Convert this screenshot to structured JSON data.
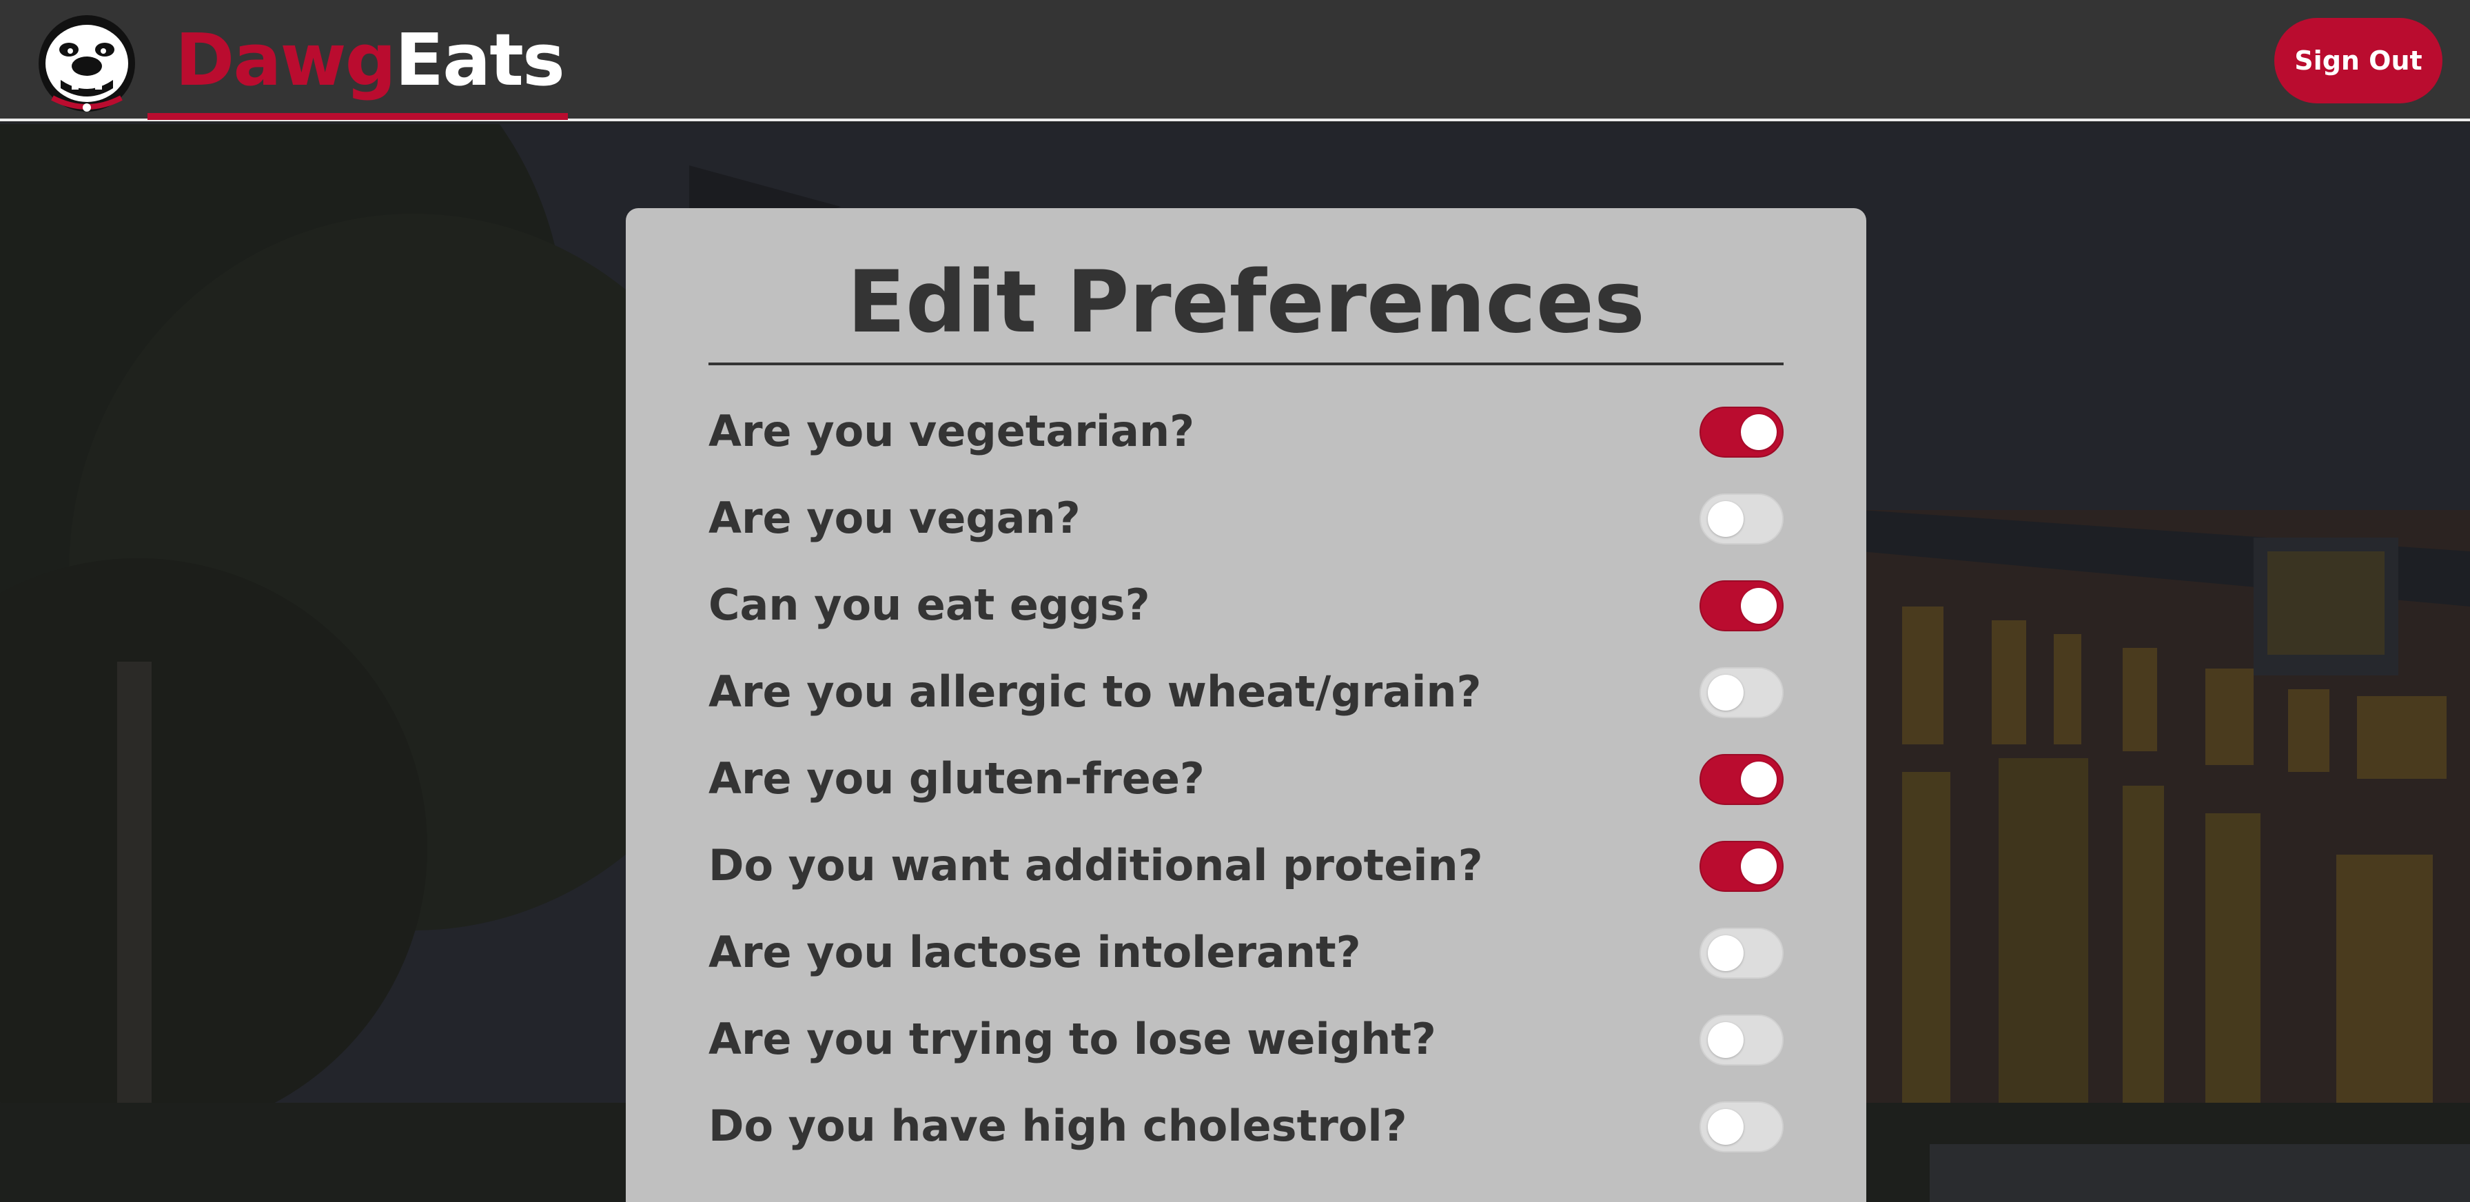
{
  "header": {
    "brand_part1": "Dawg",
    "brand_part2": "Eats",
    "signout_label": "Sign Out",
    "logo_alt": "Bulldog mascot logo"
  },
  "colors": {
    "accent": "#ba0c2f",
    "header_bg": "#343434",
    "card_bg": "#c0c0c0",
    "text_dark": "#343434"
  },
  "card": {
    "title": "Edit Preferences",
    "preferences": [
      {
        "label": "Are you vegetarian?",
        "enabled": true
      },
      {
        "label": "Are you vegan?",
        "enabled": false
      },
      {
        "label": "Can you eat eggs?",
        "enabled": true
      },
      {
        "label": "Are you allergic to wheat/grain?",
        "enabled": false
      },
      {
        "label": "Are you gluten-free?",
        "enabled": true
      },
      {
        "label": "Do you want additional protein?",
        "enabled": true
      },
      {
        "label": "Are you lactose intolerant?",
        "enabled": false
      },
      {
        "label": "Are you trying to lose weight?",
        "enabled": false
      },
      {
        "label": "Do you have high cholestrol?",
        "enabled": false
      }
    ]
  }
}
